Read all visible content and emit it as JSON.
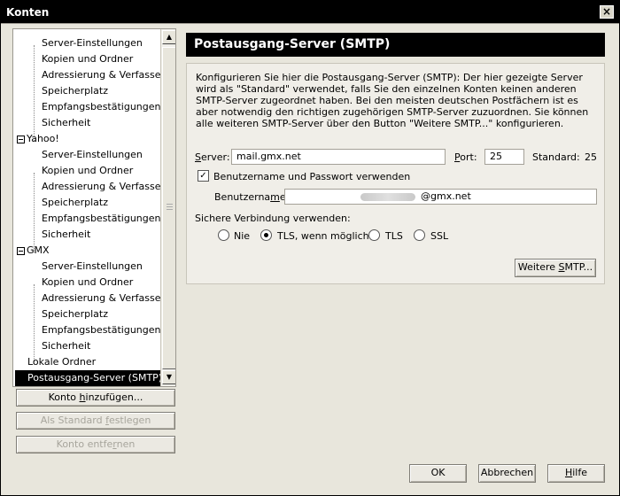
{
  "window": {
    "title": "Konten",
    "close_icon": "×"
  },
  "tree": {
    "groups": [
      {
        "children": [
          "Server-Einstellungen",
          "Kopien und Ordner",
          "Adressierung & Verfassen",
          "Speicherplatz",
          "Empfangsbestätigungen",
          "Sicherheit"
        ]
      },
      {
        "name": "Yahoo!",
        "children": [
          "Server-Einstellungen",
          "Kopien und Ordner",
          "Adressierung & Verfassen",
          "Speicherplatz",
          "Empfangsbestätigungen",
          "Sicherheit"
        ]
      },
      {
        "name": "GMX",
        "children": [
          "Server-Einstellungen",
          "Kopien und Ordner",
          "Adressierung & Verfassen",
          "Speicherplatz",
          "Empfangsbestätigungen",
          "Sicherheit"
        ]
      }
    ],
    "local": "Lokale Ordner",
    "selected": "Postausgang-Server (SMTP)"
  },
  "left_buttons": {
    "add_prefix": "Konto ",
    "add_u": "h",
    "add_suffix": "inzufügen...",
    "standard_prefix": "Als Standard ",
    "standard_u": "f",
    "standard_suffix": "estlegen",
    "remove_prefix": "Konto entfe",
    "remove_u": "r",
    "remove_suffix": "nen"
  },
  "panel": {
    "title": "Postausgang-Server (SMTP)",
    "intro": "Konfigurieren Sie hier die Postausgang-Server (SMTP): Der hier gezeigte Server wird als \"Standard\" verwendet, falls Sie den einzelnen Konten keinen anderen SMTP-Server zugeordnet haben. Bei den meisten deutschen Postfächern ist es aber notwendig den richtigen zugehörigen SMTP-Server zuzuordnen. Sie können alle weiteren SMTP-Server über den Button \"Weitere SMTP...\" konfigurieren.",
    "server_u": "S",
    "server_rest": "erver:",
    "server_value": "mail.gmx.net",
    "port_u": "P",
    "port_rest": "ort:",
    "port_value": "25",
    "standard_label": "Standard:",
    "standard_value": "25",
    "auth_checkbox_label": "Benutzername und Passwort verwenden",
    "username_prefix": "Benutzerna",
    "username_u": "m",
    "username_suffix": "e",
    "username_visible": "@gmx.net",
    "secure_label": "Sichere Verbindung verwenden:",
    "radio_options": [
      "Nie",
      "TLS, wenn möglich",
      "TLS",
      "SSL"
    ],
    "selected_radio": "TLS, wenn möglich",
    "more_smtp_prefix": "Weitere ",
    "more_smtp_u": "S",
    "more_smtp_suffix": "MTP..."
  },
  "footer": {
    "ok": "OK",
    "cancel": "Abbrechen",
    "help_u": "H",
    "help_rest": "ilfe"
  }
}
